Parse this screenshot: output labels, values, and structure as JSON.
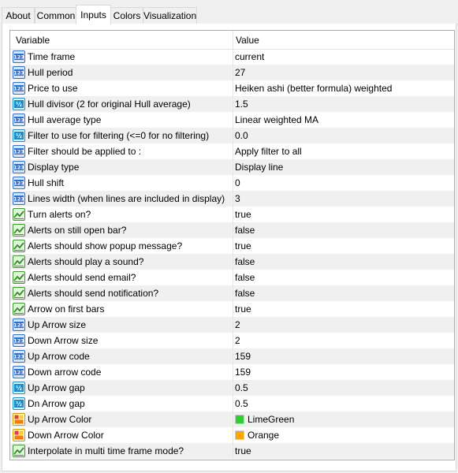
{
  "tabs": [
    {
      "label": "About"
    },
    {
      "label": "Common"
    },
    {
      "label": "Inputs",
      "active": true
    },
    {
      "label": "Colors"
    },
    {
      "label": "Visualization"
    }
  ],
  "header": {
    "variable": "Variable",
    "value": "Value"
  },
  "rows": [
    {
      "icon": "int-icon",
      "name": "Time frame",
      "value": "current"
    },
    {
      "icon": "int-icon",
      "name": "Hull period",
      "value": "27"
    },
    {
      "icon": "int-icon",
      "name": "Price to use",
      "value": "Heiken ashi (better formula) weighted"
    },
    {
      "icon": "double-icon",
      "name": "Hull divisor (2 for original Hull average)",
      "value": "1.5"
    },
    {
      "icon": "int-icon",
      "name": "Hull average type",
      "value": "Linear weighted MA"
    },
    {
      "icon": "double-icon",
      "name": "Filter to use for filtering (<=0 for no filtering)",
      "value": "0.0"
    },
    {
      "icon": "int-icon",
      "name": "Filter should be applied to :",
      "value": "Apply filter to all"
    },
    {
      "icon": "int-icon",
      "name": "Display type",
      "value": "Display line"
    },
    {
      "icon": "int-icon",
      "name": "Hull shift",
      "value": "0"
    },
    {
      "icon": "int-icon",
      "name": "Lines width (when lines are included in display)",
      "value": "3"
    },
    {
      "icon": "bool-icon",
      "name": "Turn alerts on?",
      "value": "true"
    },
    {
      "icon": "bool-icon",
      "name": "Alerts on still open bar?",
      "value": "false"
    },
    {
      "icon": "bool-icon",
      "name": "Alerts should show popup message?",
      "value": "true"
    },
    {
      "icon": "bool-icon",
      "name": "Alerts should play a sound?",
      "value": "false"
    },
    {
      "icon": "bool-icon",
      "name": "Alerts should send email?",
      "value": "false"
    },
    {
      "icon": "bool-icon",
      "name": "Alerts should send notification?",
      "value": "false"
    },
    {
      "icon": "bool-icon",
      "name": "Arrow on first bars",
      "value": "true"
    },
    {
      "icon": "int-icon",
      "name": "Up Arrow size",
      "value": "2"
    },
    {
      "icon": "int-icon",
      "name": "Down Arrow size",
      "value": "2"
    },
    {
      "icon": "int-icon",
      "name": "Up Arrow code",
      "value": "159"
    },
    {
      "icon": "int-icon",
      "name": "Down arrow code",
      "value": "159"
    },
    {
      "icon": "double-icon",
      "name": "Up Arrow gap",
      "value": "0.5"
    },
    {
      "icon": "double-icon",
      "name": "Dn Arrow gap",
      "value": "0.5"
    },
    {
      "icon": "color-icon",
      "name": "Up Arrow Color",
      "value": "LimeGreen",
      "swatch": "#32cd32"
    },
    {
      "icon": "color-icon",
      "name": "Down Arrow Color",
      "value": "Orange",
      "swatch": "#ffa500"
    },
    {
      "icon": "bool-icon",
      "name": "Interpolate in multi time frame mode?",
      "value": "true"
    }
  ]
}
